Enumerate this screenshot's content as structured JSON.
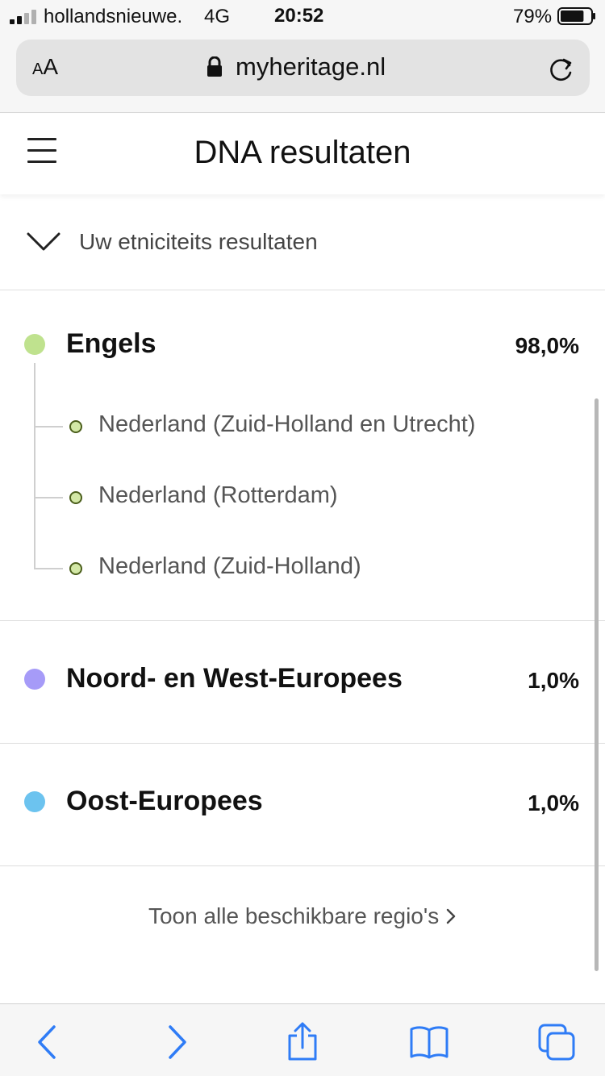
{
  "status_bar": {
    "carrier": "hollandsnieuwe.",
    "network": "4G",
    "time": "20:52",
    "battery_percent": "79%",
    "battery_level": 0.79
  },
  "browser": {
    "text_size_label_small": "A",
    "text_size_label_large": "A",
    "domain": "myheritage.nl"
  },
  "header": {
    "title": "DNA resultaten"
  },
  "accordion": {
    "label": "Uw etniciteits resultaten"
  },
  "ethnicities": [
    {
      "name": "Engels",
      "percent": "98,0%",
      "color": "#bfe28e",
      "subregions": [
        "Nederland (Zuid-Holland en Utrecht)",
        "Nederland (Rotterdam)",
        "Nederland (Zuid-Holland)"
      ]
    },
    {
      "name": "Noord- en West-Europees",
      "percent": "1,0%",
      "color": "#a69bf8"
    },
    {
      "name": "Oost-Europees",
      "percent": "1,0%",
      "color": "#6cc3ef"
    }
  ],
  "show_all": {
    "label": "Toon alle beschikbare regio's"
  },
  "toolbar": {
    "accent_color": "#2f7cf6",
    "icons": [
      "back-icon",
      "forward-icon",
      "share-icon",
      "bookmarks-icon",
      "tabs-icon"
    ]
  }
}
